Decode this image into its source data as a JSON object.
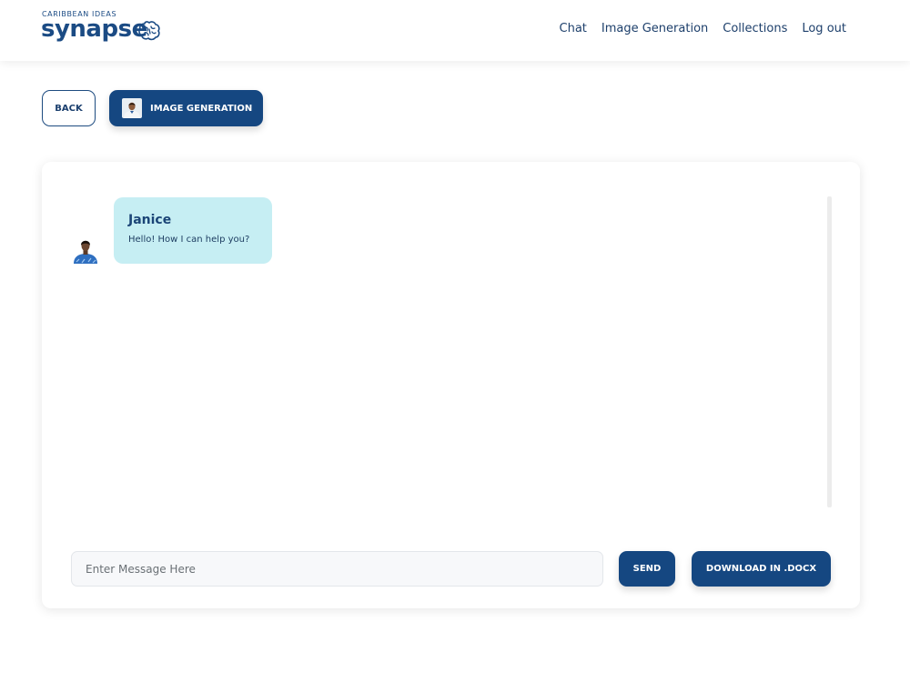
{
  "header": {
    "logo_tagline": "CARIBBEAN IDEAS",
    "logo_word": "synapse",
    "logo_icon": "brain-icon",
    "nav": [
      {
        "label": "Chat"
      },
      {
        "label": "Image Generation"
      },
      {
        "label": "Collections"
      },
      {
        "label": "Log out"
      }
    ]
  },
  "toolbar": {
    "back_label": "BACK",
    "mode_label": "IMAGE GENERATION",
    "mode_icon": "avatar-male"
  },
  "chat": {
    "messages": [
      {
        "sender": "Janice",
        "text": "Hello! How I can help you?",
        "avatar": "avatar-female"
      }
    ]
  },
  "composer": {
    "placeholder": "Enter Message Here",
    "value": "",
    "send_label": "SEND",
    "download_label": "DOWNLOAD IN .DOCX"
  },
  "colors": {
    "primary": "#154781",
    "bubble": "#c6eef3",
    "text": "#1b3f6e"
  }
}
